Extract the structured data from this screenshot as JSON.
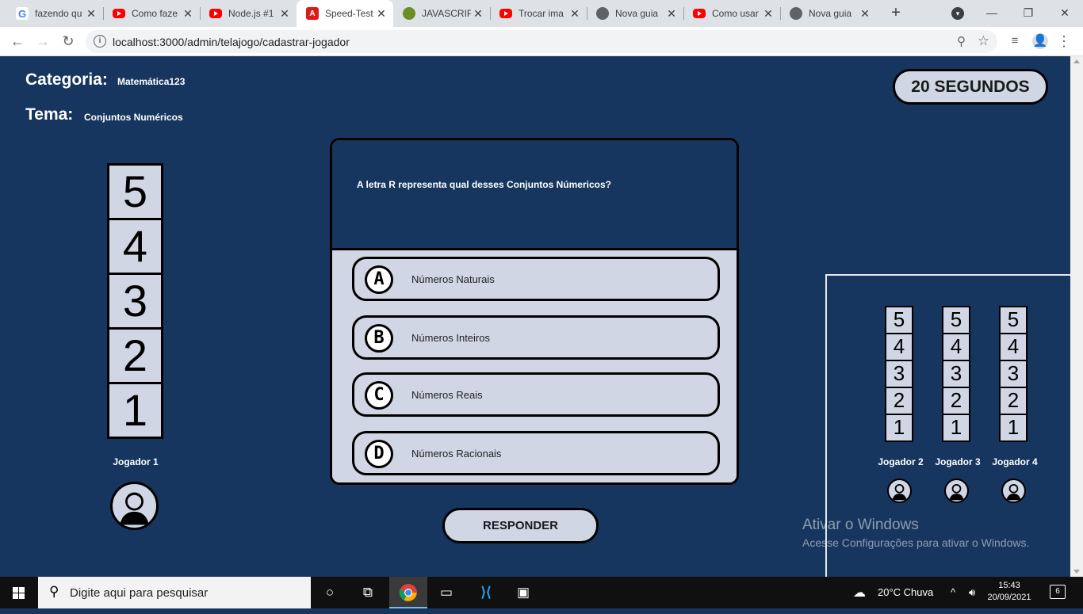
{
  "browser": {
    "tabs": [
      {
        "title": "fazendo qu",
        "icon": "google-icon"
      },
      {
        "title": "Como faze",
        "icon": "youtube-icon"
      },
      {
        "title": "Node.js #1",
        "icon": "youtube-icon"
      },
      {
        "title": "Speed-Test",
        "icon": "angular-icon",
        "active": true
      },
      {
        "title": "JAVASCRIP",
        "icon": "js-icon"
      },
      {
        "title": "Trocar ima",
        "icon": "youtube-icon"
      },
      {
        "title": "Nova guia",
        "icon": "chrome-icon"
      },
      {
        "title": "Como usar",
        "icon": "youtube-icon"
      },
      {
        "title": "Nova guia",
        "icon": "chrome-icon"
      }
    ],
    "url": "localhost:3000/admin/telajogo/cadastrar-jogador"
  },
  "game": {
    "categoria_label": "Categoria:",
    "categoria_value": "Matemática123",
    "tema_label": "Tema:",
    "tema_value": "Conjuntos Numéricos",
    "timer": "20 SEGUNDOS",
    "question": "A letra R representa qual desses Conjuntos Númericos?",
    "options": [
      {
        "letter": "A",
        "text": "Números Naturais"
      },
      {
        "letter": "B",
        "text": "Números Inteiros"
      },
      {
        "letter": "C",
        "text": "Números Reais"
      },
      {
        "letter": "D",
        "text": "Números Racionais"
      }
    ],
    "respond_label": "RESPONDER",
    "ladder_levels": [
      "5",
      "4",
      "3",
      "2",
      "1"
    ],
    "players": [
      "Jogador 1",
      "Jogador 2",
      "Jogador 3",
      "Jogador 4"
    ],
    "colors": {
      "background": "#17365f",
      "panel": "#d0d6e4",
      "border": "#000000"
    }
  },
  "watermark": {
    "line1": "Ativar o Windows",
    "line2": "Acesse Configurações para ativar o Windows."
  },
  "taskbar": {
    "search_placeholder": "Digite aqui para pesquisar",
    "weather": "20°C  Chuva",
    "time": "15:43",
    "date": "20/09/2021",
    "notifications": "6"
  }
}
